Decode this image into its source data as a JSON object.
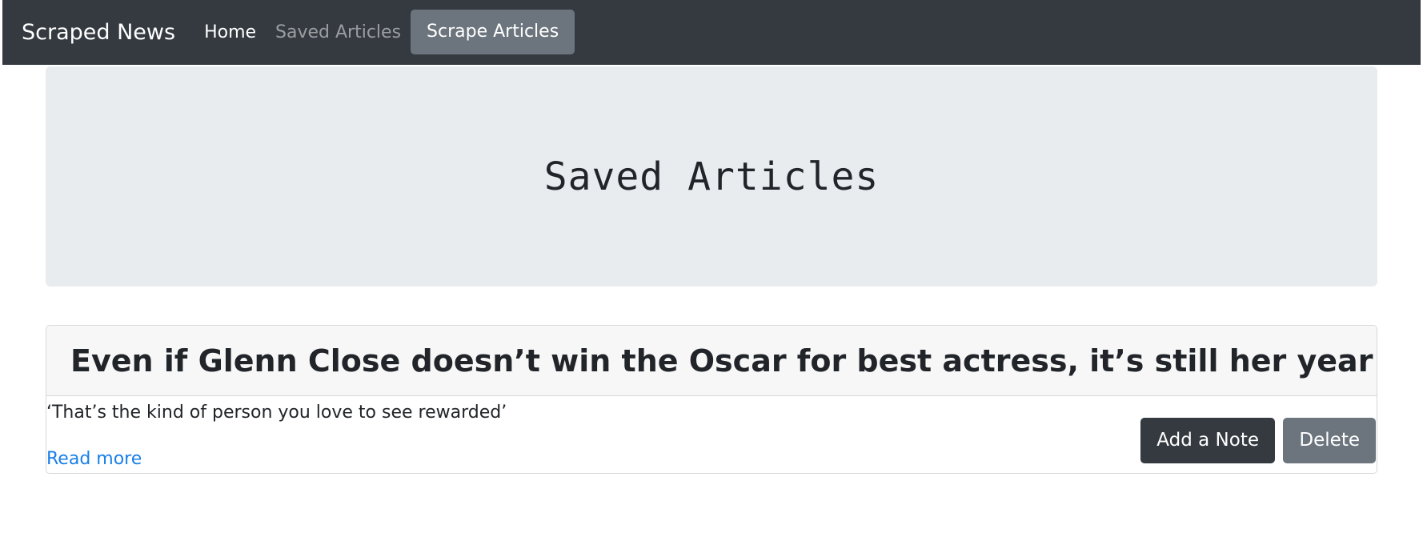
{
  "navbar": {
    "brand": "Scraped News",
    "home": "Home",
    "saved": "Saved Articles",
    "scrape": "Scrape Articles"
  },
  "jumbotron": {
    "title": "Saved Articles"
  },
  "articles": [
    {
      "headline": "Even if Glenn Close doesn’t win the Oscar for best actress, it’s still her year",
      "summary": "‘That’s the kind of person you love to see rewarded’",
      "read_more": "Read more",
      "add_note": "Add a Note",
      "delete": "Delete"
    }
  ]
}
